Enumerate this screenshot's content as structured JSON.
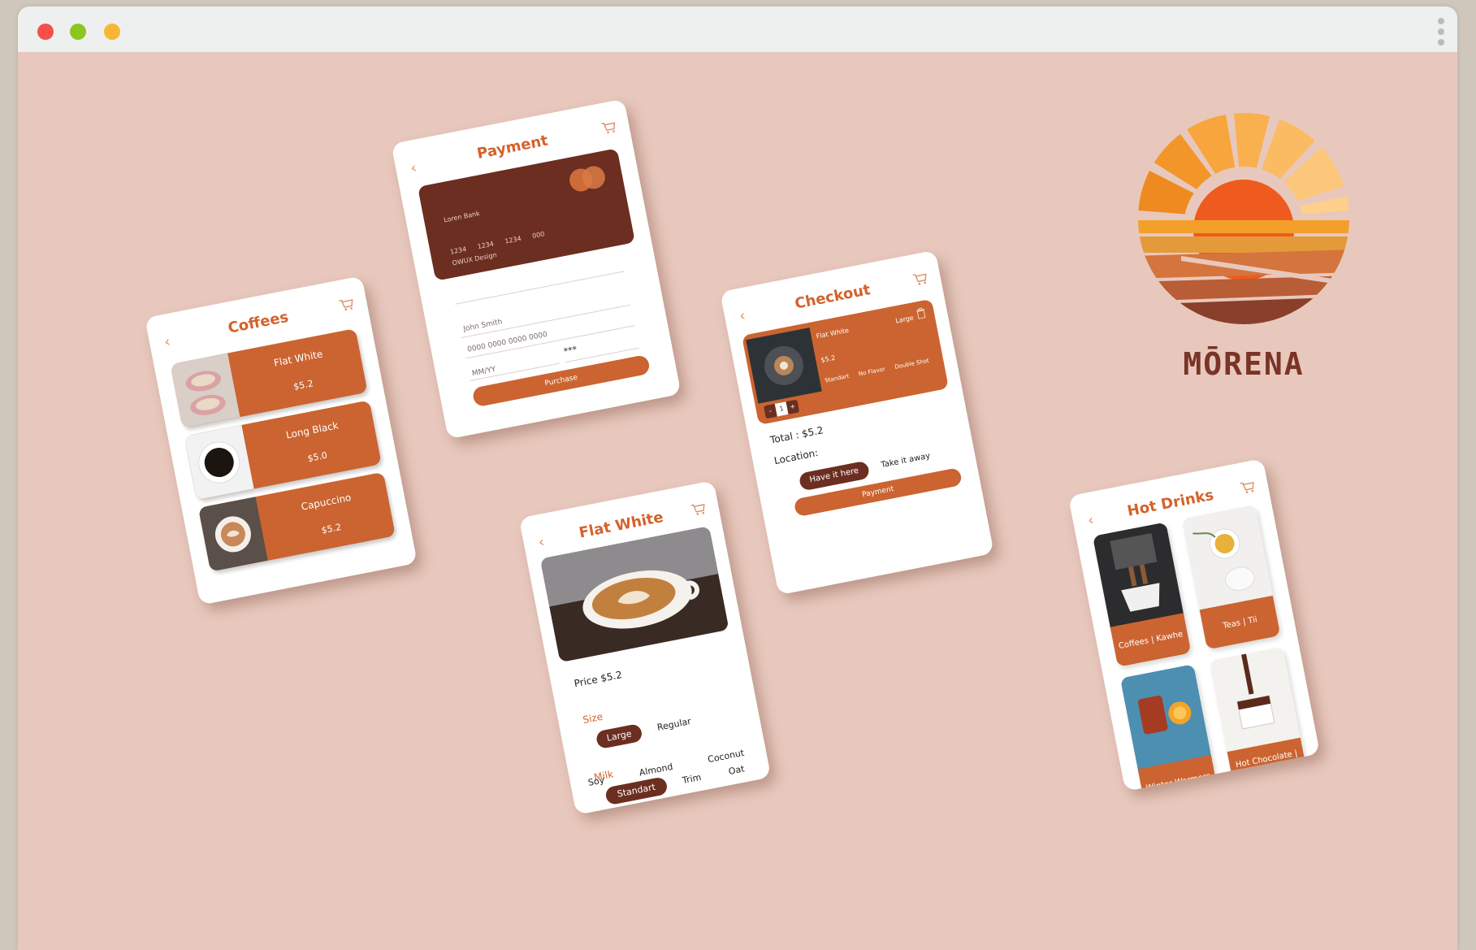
{
  "window": {
    "controls": {
      "close_color": "#f5504a",
      "minimize_color": "#8bc720",
      "maximize_color": "#f7b733"
    },
    "menu_icon": "kebab-icon"
  },
  "colors": {
    "background": "#e8c8bd",
    "accent": "#cb6430",
    "dark": "#6b2e21",
    "title": "#d4622c"
  },
  "brand": {
    "name": "MŌRENA",
    "logo_icon": "sunset-logo-icon"
  },
  "screens": {
    "coffees": {
      "title": "Coffees",
      "items": [
        {
          "name": "Flat White",
          "price": "$5.2"
        },
        {
          "name": "Long Black",
          "price": "$5.0"
        },
        {
          "name": "Capuccino",
          "price": "$5.2"
        }
      ]
    },
    "payment": {
      "title": "Payment",
      "card": {
        "bank": "Loren Bank",
        "number": [
          "1234",
          "1234",
          "1234",
          "000"
        ],
        "holder": "OWUX Design"
      },
      "fields": {
        "name": "John Smith",
        "card_number": "0000 0000 0000 0000",
        "expiry": "MM/YY",
        "cvv": "***"
      },
      "purchase_label": "Purchase"
    },
    "checkout": {
      "title": "Checkout",
      "item": {
        "name": "Flat White",
        "size": "Large",
        "price": "$5.2",
        "options": [
          "Standart",
          "No Flavor",
          "Double Shot"
        ]
      },
      "stepper": {
        "minus": "-",
        "qty": "1",
        "plus": "+"
      },
      "total": "Total : $5.2",
      "location_label": "Location:",
      "have_it_here": "Have it here",
      "take_away": "Take it away",
      "payment_label": "Payment"
    },
    "flatwhite": {
      "title": "Flat White",
      "price": "Price $5.2",
      "size_label": "Size",
      "sizes": {
        "selected": "Large",
        "other": "Regular"
      },
      "milk_label": "Milk",
      "milks": {
        "selected": "Standart",
        "trim": "Trim",
        "oat": "Oat",
        "soy": "Soy",
        "almond": "Almond",
        "coconut": "Coconut"
      }
    },
    "hotdrinks": {
      "title": "Hot Drinks",
      "categories": [
        "Coffees | Kawhe",
        "Teas | Tii",
        "Winter Warmers",
        "Hot Chocolate | Tiakarete Wera"
      ]
    }
  }
}
